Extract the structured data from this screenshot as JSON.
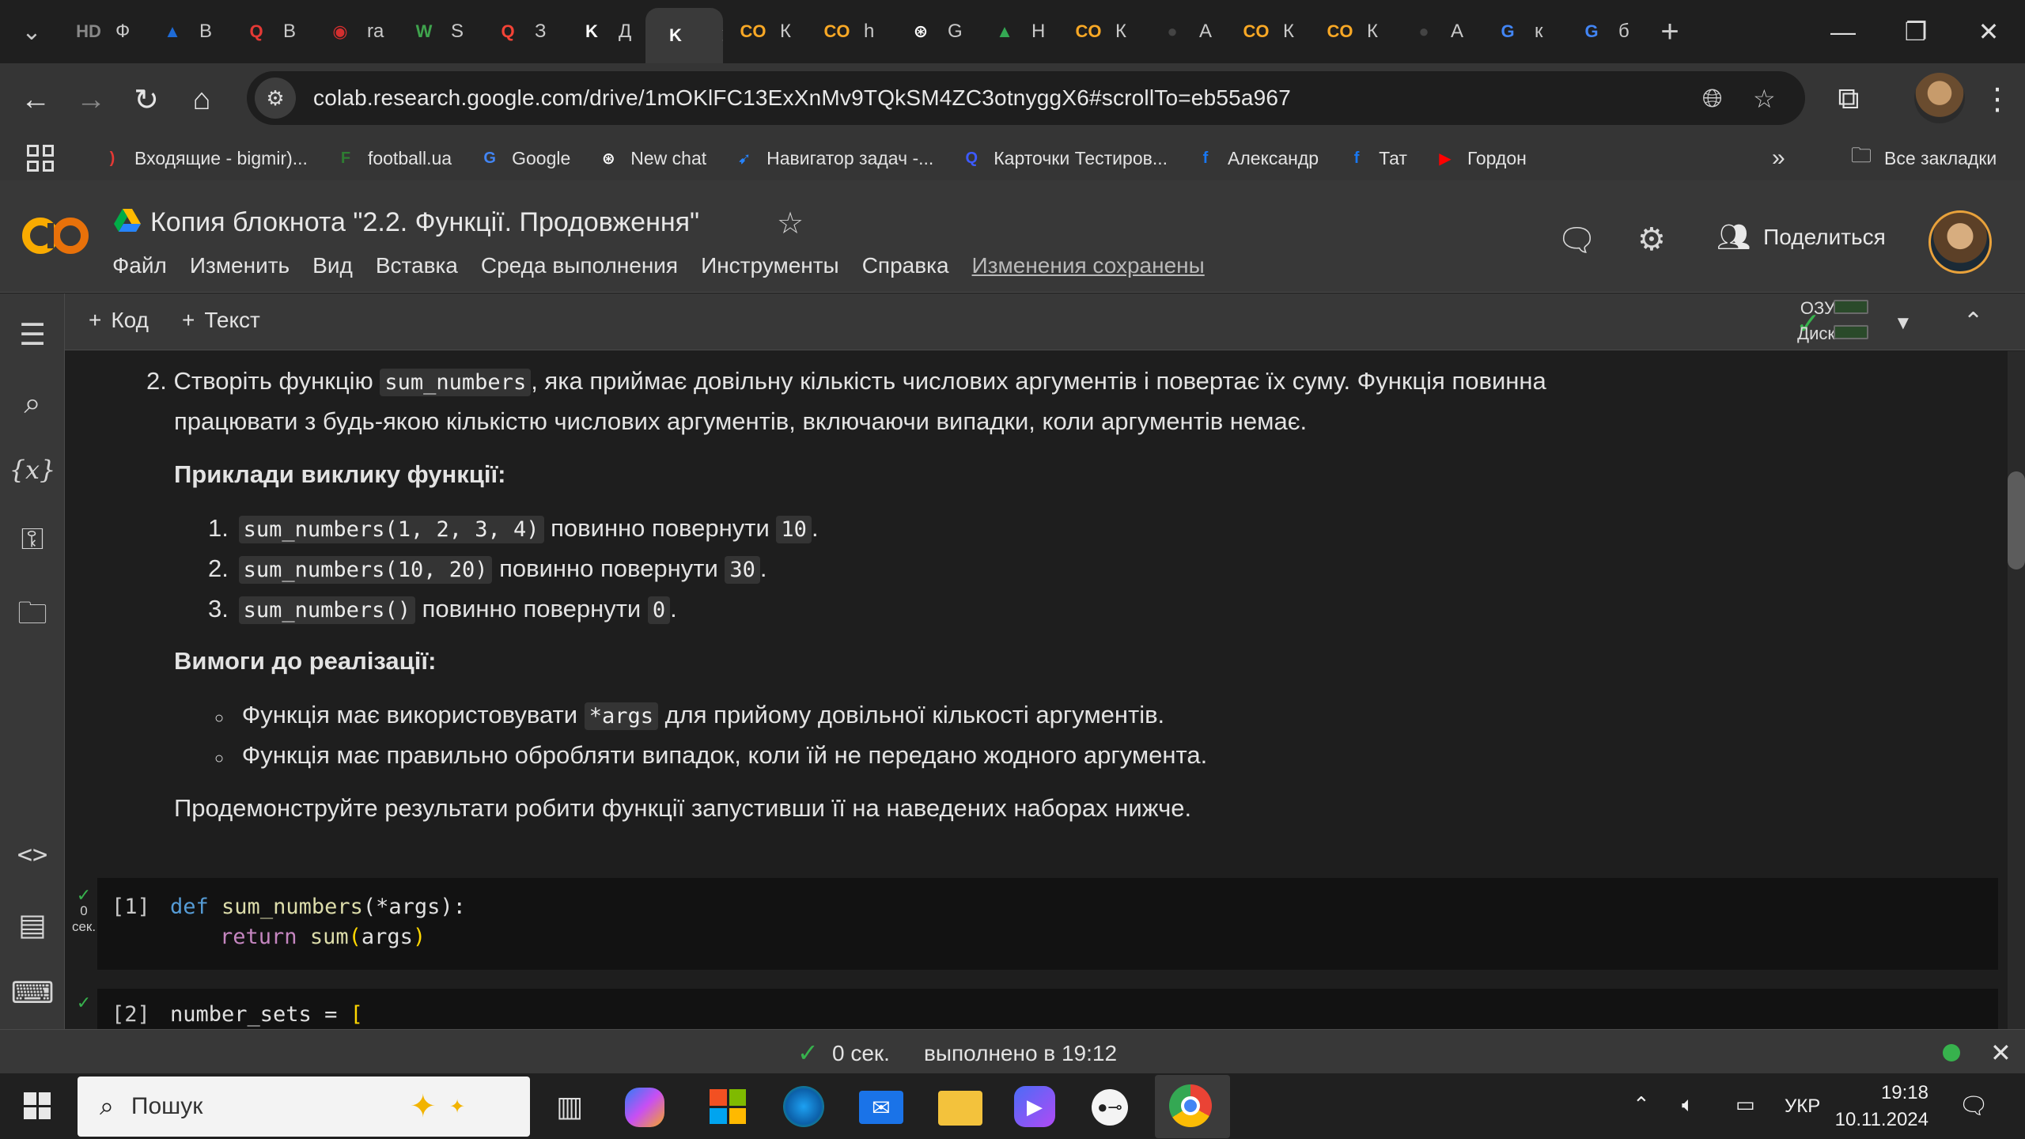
{
  "browser": {
    "tabs": [
      {
        "icon": "HD",
        "label": "Ф",
        "color": "#888888"
      },
      {
        "icon": "▲",
        "label": "В",
        "color": "#1e6bd6"
      },
      {
        "icon": "Q",
        "label": "В",
        "color": "#e53935"
      },
      {
        "icon": "◉",
        "label": "ra",
        "color": "#d32f2f"
      },
      {
        "icon": "W",
        "label": "S",
        "color": "#3fa34d"
      },
      {
        "icon": "Q",
        "label": "З",
        "color": "#f44336"
      },
      {
        "icon": "K",
        "label": "Д",
        "color": "#ffffff"
      },
      {
        "icon": "K",
        "label": "",
        "color": "#ffffff",
        "active": true
      },
      {
        "icon": "CO",
        "label": "К",
        "color": "#f9a825"
      },
      {
        "icon": "CO",
        "label": "h",
        "color": "#f9a825"
      },
      {
        "icon": "⊛",
        "label": "G",
        "color": "#ffffff"
      },
      {
        "icon": "▲",
        "label": "Н",
        "color": "#34a853"
      },
      {
        "icon": "CO",
        "label": "К",
        "color": "#f9a825"
      },
      {
        "icon": "●",
        "label": "А",
        "color": "#444444"
      },
      {
        "icon": "CO",
        "label": "К",
        "color": "#f9a825"
      },
      {
        "icon": "CO",
        "label": "К",
        "color": "#f9a825"
      },
      {
        "icon": "●",
        "label": "А",
        "color": "#444444"
      },
      {
        "icon": "G",
        "label": "к",
        "color": "#4285f4"
      },
      {
        "icon": "G",
        "label": "б",
        "color": "#4285f4"
      }
    ],
    "url": "colab.research.google.com/drive/1mOKlFC13ExXnMv9TQkSM4ZC3otnyggX6#scrollTo=eb55a967",
    "bookmarks": [
      {
        "icon": ")",
        "label": "Входящие - bigmir)...",
        "color": "#e53935"
      },
      {
        "icon": "F",
        "label": "football.ua",
        "color": "#2e7d32"
      },
      {
        "icon": "G",
        "label": "Google",
        "color": "#4285f4"
      },
      {
        "icon": "⊛",
        "label": "New chat",
        "color": "#ffffff"
      },
      {
        "icon": "➹",
        "label": "Навигатор задач -...",
        "color": "#2684ff"
      },
      {
        "icon": "Q",
        "label": "Карточки Тестиров...",
        "color": "#3d5afe"
      },
      {
        "icon": "f",
        "label": "Александр",
        "color": "#1877f2"
      },
      {
        "icon": "f",
        "label": "Тат",
        "color": "#1877f2"
      },
      {
        "icon": "▶",
        "label": "Гордон",
        "color": "#ff0000"
      }
    ],
    "all_bookmarks": "Все закладки"
  },
  "colab": {
    "title": "Копия блокнота \"2.2. Функції. Продовження\"",
    "menu": [
      "Файл",
      "Изменить",
      "Вид",
      "Вставка",
      "Среда выполнения",
      "Инструменты",
      "Справка"
    ],
    "saved_status": "Изменения сохранены",
    "share_label": "Поделиться",
    "add_code": "Код",
    "add_text": "Текст",
    "ram_label": "ОЗУ",
    "disk_label": "Диск"
  },
  "notebook": {
    "task_number": "2.",
    "task_line1_a": "Створіть функцію",
    "task_code": "sum_numbers",
    "task_line1_b": ", яка приймає довільну кількість числових аргументів і повертає їх суму. Функція повинна",
    "task_line2": "працювати з будь-якою кількістю числових аргументів, включаючи випадки, коли аргументів немає.",
    "examples_heading": "Приклади виклику функції:",
    "examples": [
      {
        "n": "1.",
        "call": "sum_numbers(1, 2, 3, 4)",
        "text": "повинно повернути",
        "result": "10",
        "end": "."
      },
      {
        "n": "2.",
        "call": "sum_numbers(10, 20)",
        "text": "повинно повернути",
        "result": "30",
        "end": "."
      },
      {
        "n": "3.",
        "call": "sum_numbers()",
        "text": "повинно повернути",
        "result": "0",
        "end": "."
      }
    ],
    "req_heading": "Вимоги до реалізації:",
    "req1_a": "Функція має використовувати",
    "req1_code": "*args",
    "req1_b": "для прийому довільної кількості аргументів.",
    "req2": "Функція має правильно обробляти випадок, коли їй не передано жодного аргумента.",
    "demo": "Продемонструйте результати робити функції запустивши її на наведених наборах нижче.",
    "cell1": {
      "exec": "[1]",
      "time_value": "0",
      "time_unit": "сек.",
      "line1_kw": "def",
      "line1_fn": "sum_numbers",
      "line1_open": "(",
      "line1_arg": "*args",
      "line1_close": "):",
      "line2_kw": "return",
      "line2_fn": "sum",
      "line2_open": "(",
      "line2_arg": "args",
      "line2_close": ")"
    },
    "cell2": {
      "exec": "[2]",
      "line1_id": "number_sets",
      "line1_op": " = ",
      "line1_br": "["
    }
  },
  "statusbar": {
    "time": "0 сек.",
    "executed": "выполнено в 19:12"
  },
  "taskbar": {
    "search_placeholder": "Пошук",
    "lang": "УКР",
    "time": "19:18",
    "date": "10.11.2024"
  }
}
